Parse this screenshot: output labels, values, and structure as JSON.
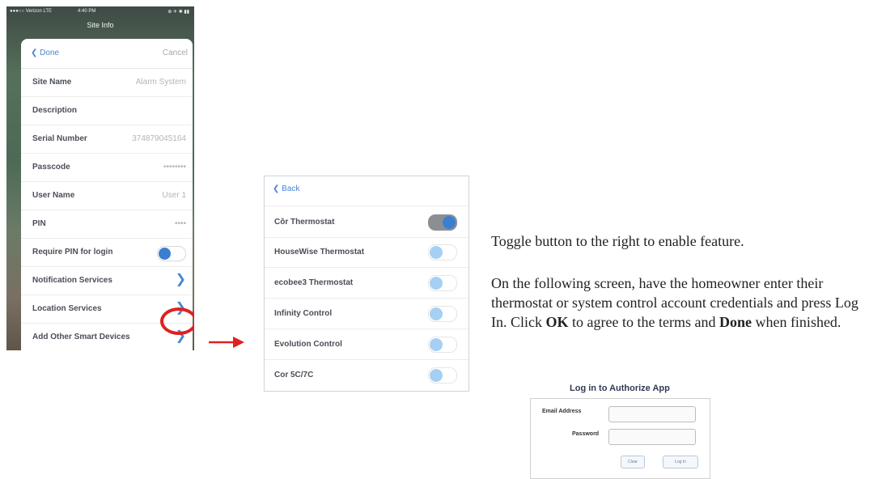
{
  "left_phone": {
    "status": {
      "carrier": "●●●○○ Verizon  LTE",
      "time": "4:40 PM",
      "icons": "⊕ ✈ ✱ ▮▮"
    },
    "title": "Site Info",
    "nav": {
      "done_label": "Done",
      "cancel_label": "Cancel"
    },
    "rows": [
      {
        "label": "Site Name",
        "value": "Alarm System"
      },
      {
        "label": "Description",
        "value": ""
      },
      {
        "label": "Serial Number",
        "value": "374879045164"
      },
      {
        "label": "Passcode",
        "value": "••••••••"
      },
      {
        "label": "User Name",
        "value": "User 1"
      },
      {
        "label": "PIN",
        "value": "••••"
      },
      {
        "label": "Require PIN for login",
        "toggle": true
      },
      {
        "label": "Notification Services",
        "chevron": true
      },
      {
        "label": "Location Services",
        "chevron": true
      },
      {
        "label": "Add Other Smart Devices",
        "chevron": true
      }
    ]
  },
  "devices_screen": {
    "back_label": "Back",
    "items": [
      {
        "label": "Côr Thermostat",
        "on": true
      },
      {
        "label": "HouseWise Thermostat",
        "on": false
      },
      {
        "label": "ecobee3 Thermostat",
        "on": false
      },
      {
        "label": "Infinity Control",
        "on": false
      },
      {
        "label": "Evolution Control",
        "on": false
      },
      {
        "label": "Cor 5C/7C",
        "on": false
      }
    ]
  },
  "instructions": {
    "line1": "Toggle button to the right to enable feature.",
    "p2_a": "On the following screen, have the homeowner enter their thermostat or system control account credentials and press Log In. Click ",
    "p2_ok": "OK",
    "p2_b": " to agree to the terms and ",
    "p2_done": "Done",
    "p2_c": " when finished."
  },
  "login": {
    "title": "Log in to Authorize App",
    "email_label": "Email Address",
    "password_label": "Password",
    "clear_label": "Clear",
    "login_label": "Log In"
  },
  "colors": {
    "accent": "#3b7fd0",
    "highlight": "#e02020"
  }
}
